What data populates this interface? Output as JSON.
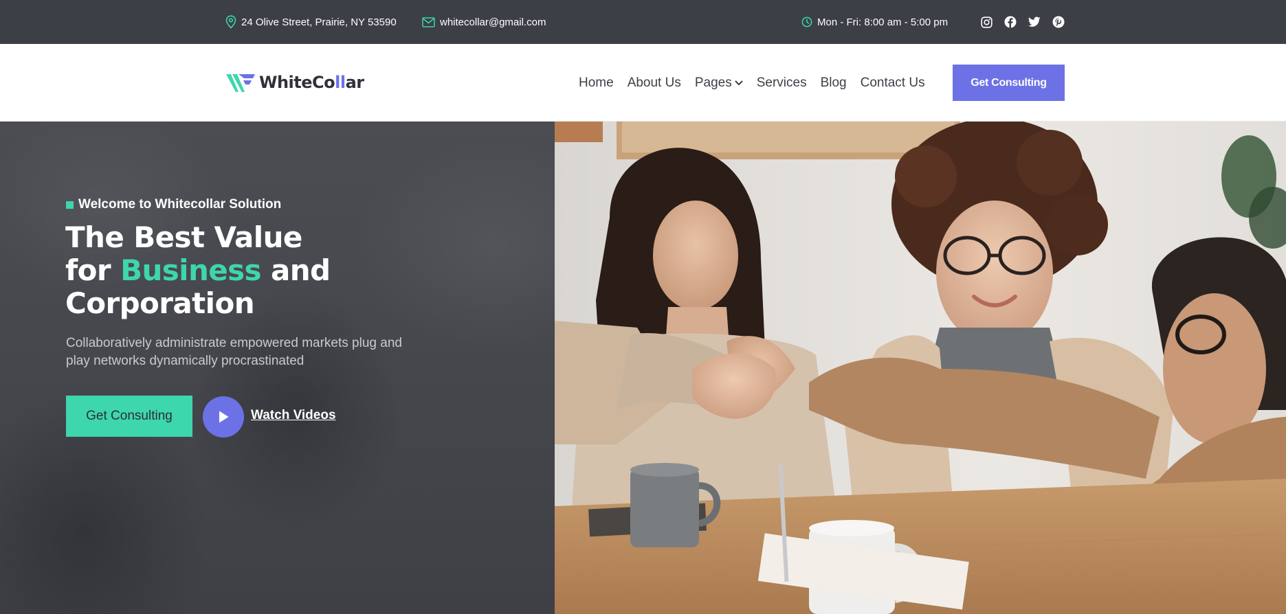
{
  "colors": {
    "accent_green": "#3ed6ac",
    "accent_purple": "#6c72e6",
    "topbar_bg": "#3c3f46",
    "text_dark": "#3c3f46"
  },
  "topbar": {
    "address": {
      "icon": "map-pin-icon",
      "text": "24 Olive Street, Prairie, NY 53590"
    },
    "email": {
      "icon": "envelope-icon",
      "text": "whitecollar@gmail.com"
    },
    "hours": {
      "icon": "clock-icon",
      "text": "Mon - Fri: 8:00 am - 5:00 pm"
    },
    "social": [
      "instagram-icon",
      "facebook-icon",
      "twitter-icon",
      "pinterest-icon"
    ]
  },
  "nav": {
    "logo": {
      "text_main": "WhiteCo",
      "text_accent": "ll",
      "text_end": "ar"
    },
    "menu": [
      {
        "label": "Home"
      },
      {
        "label": "About Us"
      },
      {
        "label": "Pages",
        "icon": "chevron-down-icon"
      },
      {
        "label": "Services"
      },
      {
        "label": "Blog"
      },
      {
        "label": "Contact Us"
      }
    ],
    "cta_label": "Get Consulting"
  },
  "hero": {
    "eyebrow": "Welcome to Whitecollar Solution",
    "headline_line1": "The Best Value",
    "headline_for": "for ",
    "headline_highlight": "Business",
    "headline_and": " and",
    "headline_line3": "Corporation",
    "lede": "Collaboratively administrate empowered markets plug and play networks dynamically procrastinated",
    "primary_cta": "Get Consulting",
    "play_icon": "play-icon",
    "video_link": "Watch Videos"
  }
}
